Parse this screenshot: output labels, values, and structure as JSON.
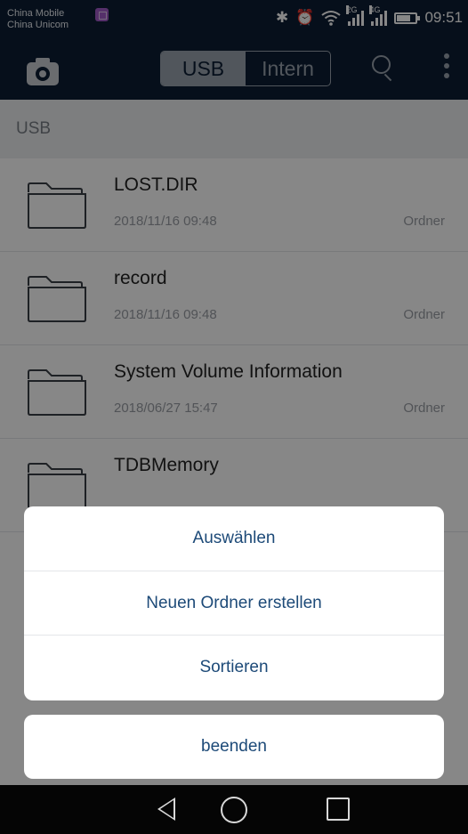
{
  "status_bar": {
    "carrier_1": "China Mobile",
    "carrier_2": "China Unicom",
    "signal_1_tag": "2G",
    "signal_2_tag": "4G",
    "time": "09:51"
  },
  "toolbar": {
    "tab_usb": "USB",
    "tab_intern": "Intern",
    "selected_tab": "USB"
  },
  "path": "USB",
  "files": [
    {
      "name": "LOST.DIR",
      "date": "2018/11/16 09:48",
      "kind": "Ordner"
    },
    {
      "name": "record",
      "date": "2018/11/16 09:48",
      "kind": "Ordner"
    },
    {
      "name": "System Volume Information",
      "date": "2018/06/27 15:47",
      "kind": "Ordner"
    },
    {
      "name": "TDBMemory",
      "date": "",
      "kind": ""
    }
  ],
  "action_sheet": {
    "items": [
      "Auswählen",
      "Neuen Ordner erstellen",
      "Sortieren"
    ],
    "cancel": "beenden"
  },
  "colors": {
    "header_bg": "#0d1e33",
    "action_text": "#1d4a78"
  }
}
